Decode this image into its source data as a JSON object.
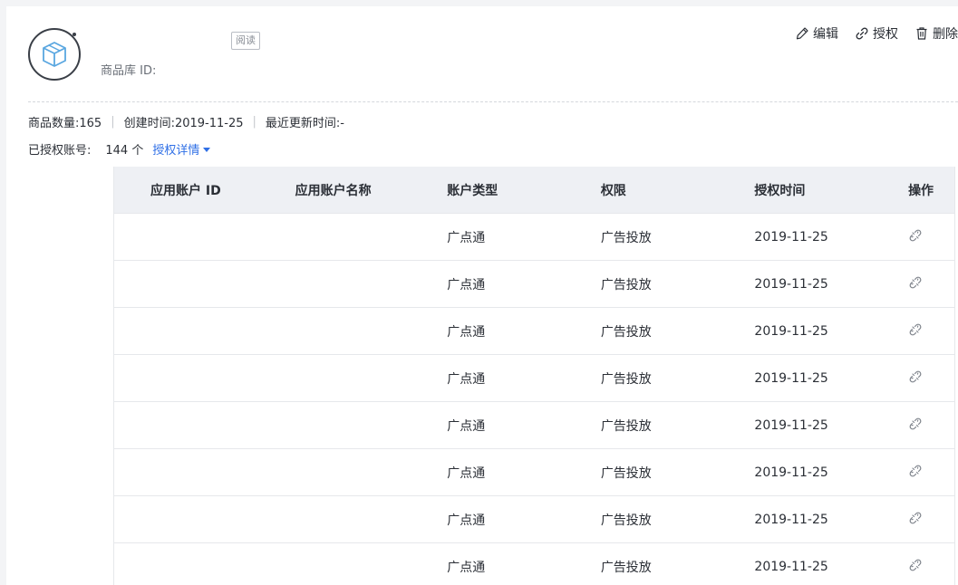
{
  "header": {
    "lib_id_label": "商品库 ID:",
    "read_badge": "阅读",
    "actions": {
      "edit": "编辑",
      "authorize": "授权",
      "delete": "删除"
    }
  },
  "meta": {
    "product_count": "商品数量:165",
    "created_time": "创建时间:2019-11-25",
    "updated_time": "最近更新时间:-"
  },
  "auth": {
    "label": "已授权账号:",
    "count": "144 个",
    "detail_link": "授权详情"
  },
  "table": {
    "columns": [
      "应用账户 ID",
      "应用账户名称",
      "账户类型",
      "权限",
      "授权时间",
      "操作"
    ],
    "rows": [
      {
        "account_id": "",
        "account_name": "",
        "type": "广点通",
        "permission": "广告投放",
        "time": "2019-11-25"
      },
      {
        "account_id": "",
        "account_name": "",
        "type": "广点通",
        "permission": "广告投放",
        "time": "2019-11-25"
      },
      {
        "account_id": "",
        "account_name": "",
        "type": "广点通",
        "permission": "广告投放",
        "time": "2019-11-25"
      },
      {
        "account_id": "",
        "account_name": "",
        "type": "广点通",
        "permission": "广告投放",
        "time": "2019-11-25"
      },
      {
        "account_id": "",
        "account_name": "",
        "type": "广点通",
        "permission": "广告投放",
        "time": "2019-11-25"
      },
      {
        "account_id": "",
        "account_name": "",
        "type": "广点通",
        "permission": "广告投放",
        "time": "2019-11-25"
      },
      {
        "account_id": "",
        "account_name": "",
        "type": "广点通",
        "permission": "广告投放",
        "time": "2019-11-25"
      },
      {
        "account_id": "",
        "account_name": "",
        "type": "广点通",
        "permission": "广告投放",
        "time": "2019-11-25"
      }
    ]
  },
  "icons": {
    "avatar": "box-icon",
    "edit": "pencil-icon",
    "authorize": "link-icon",
    "delete": "trash-icon",
    "row_action": "unlink-icon"
  },
  "colors": {
    "link": "#2f6fe6",
    "header_bg": "#eef0f4",
    "border": "#e6e8eb"
  }
}
